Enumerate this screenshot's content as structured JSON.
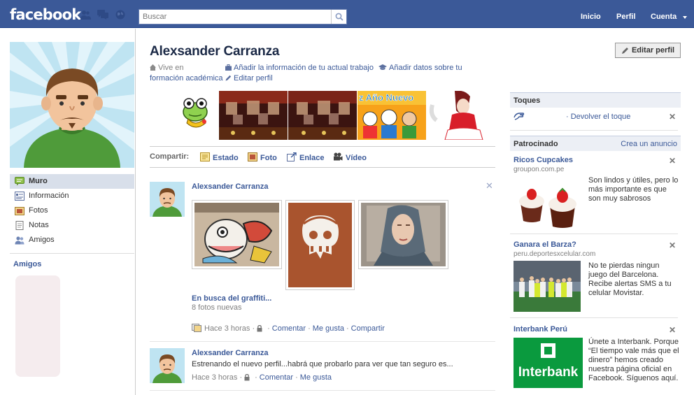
{
  "app": {
    "logo": "facebook"
  },
  "search": {
    "placeholder": "Buscar"
  },
  "topnav": {
    "inicio": "Inicio",
    "perfil": "Perfil",
    "cuenta": "Cuenta"
  },
  "leftnav": {
    "items": [
      {
        "label": "Muro",
        "icon": "wall-icon",
        "selected": true
      },
      {
        "label": "Información",
        "icon": "info-icon"
      },
      {
        "label": "Fotos",
        "icon": "photos-icon"
      },
      {
        "label": "Notas",
        "icon": "notes-icon"
      },
      {
        "label": "Amigos",
        "icon": "friends-icon"
      }
    ],
    "friends_header": "Amigos"
  },
  "profile": {
    "name": "Alexsander Carranza",
    "edit_button": "Editar perfil",
    "info": {
      "vive_en": "Vive en",
      "trabajo": "Añadir la información de tu actual trabajo",
      "estudios": "Añadir datos sobre tu",
      "formacion": "formación académica",
      "editar": "Editar perfil"
    }
  },
  "composer": {
    "label": "Compartir:",
    "items": [
      "Estado",
      "Foto",
      "Enlace",
      "Vídeo"
    ]
  },
  "stories": [
    {
      "author": "Alexsander Carranza",
      "album_title": "En busca del graffiti...",
      "album_sub": "8 fotos nuevas",
      "time": "Hace 3 horas",
      "actions": [
        "Comentar",
        "Me gusta",
        "Compartir"
      ]
    },
    {
      "author": "Alexsander Carranza",
      "text": "Estrenando el nuevo perfil...habrá que probarlo para ver que tan seguro es...",
      "time": "Hace 3 horas",
      "actions": [
        "Comentar",
        "Me gusta"
      ]
    }
  ],
  "strip": {
    "card_text": "z Año Nuevo"
  },
  "right": {
    "toques_header": "Toques",
    "toques_action": "· Devolver el toque",
    "patrocinado_header": "Patrocinado",
    "crea_anuncio": "Crea un anuncio",
    "ads": [
      {
        "title": "Ricos Cupcakes",
        "domain": "groupon.com.pe",
        "text": "Son lindos y útiles, pero lo más importante es que son muy sabrosos"
      },
      {
        "title": "Ganara el Barza?",
        "domain": "peru.deportesxcelular.com",
        "text": "No te pierdas ningun juego del Barcelona. Recibe alertas SMS a tu celular Movistar."
      },
      {
        "title": "Interbank Perú",
        "logo_text": "Interbank",
        "text": "Únete a Interbank. Porque “El tiempo vale más que el dinero” hemos creado nuestra página oficial en Facebook. Síguenos aquí."
      }
    ]
  },
  "colors": {
    "brand": "#3b5998",
    "nav_selected": "#d8dfea",
    "interbank_green": "#0a9a3e"
  }
}
